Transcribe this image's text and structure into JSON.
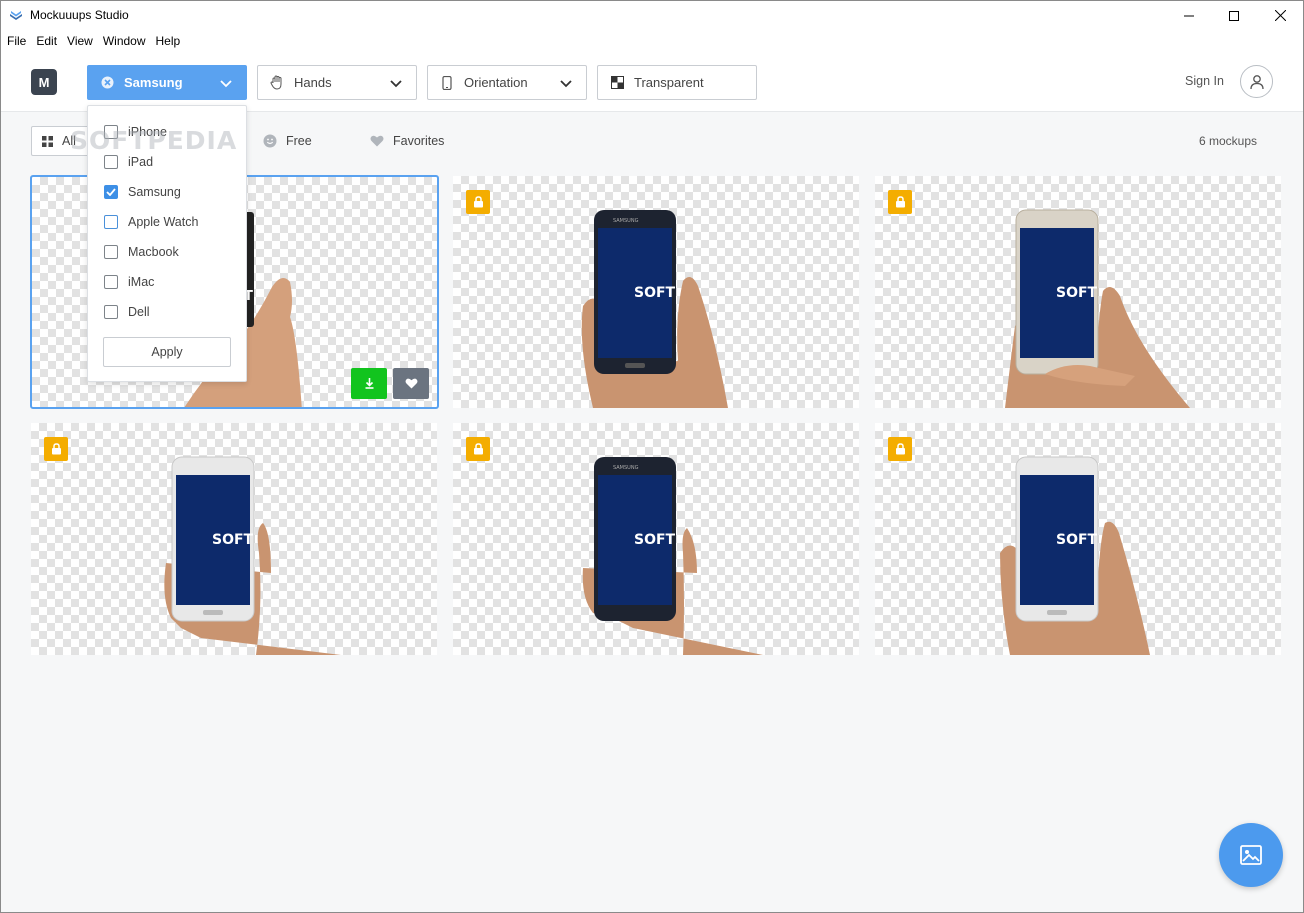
{
  "window": {
    "title": "Mockuuups Studio",
    "icon": "app-icon"
  },
  "menubar": {
    "items": [
      "File",
      "Edit",
      "View",
      "Window",
      "Help"
    ]
  },
  "toolbar": {
    "logo_letter": "M",
    "device_filter": {
      "label": "Samsung",
      "icon": "clear-icon"
    },
    "hands_filter": {
      "label": "Hands",
      "icon": "hand-icon"
    },
    "orientation_filter": {
      "label": "Orientation",
      "icon": "phone-icon"
    },
    "background_filter": {
      "label": "Transparent",
      "icon": "transparent-icon"
    },
    "sign_in": "Sign In"
  },
  "filterbar": {
    "all_label": "All",
    "free_label": "Free",
    "favorites_label": "Favorites",
    "count_label": "6 mockups"
  },
  "device_menu": {
    "options": [
      {
        "label": "iPhone",
        "checked": false
      },
      {
        "label": "iPad",
        "checked": false
      },
      {
        "label": "Samsung",
        "checked": true
      },
      {
        "label": "Apple Watch",
        "checked": false
      },
      {
        "label": "Macbook",
        "checked": false
      },
      {
        "label": "iMac",
        "checked": false
      },
      {
        "label": "Dell",
        "checked": false
      }
    ],
    "apply_label": "Apply"
  },
  "watermark": "SOFTPEDIA",
  "mockups": [
    {
      "phone_color": "black",
      "locked": false,
      "selected": true,
      "screen_text": "SOFT"
    },
    {
      "phone_color": "black",
      "locked": true,
      "selected": false,
      "screen_text": "SOFT"
    },
    {
      "phone_color": "gold",
      "locked": true,
      "selected": false,
      "screen_text": "SOFT"
    },
    {
      "phone_color": "white",
      "locked": true,
      "selected": false,
      "screen_text": "SOFT"
    },
    {
      "phone_color": "black",
      "locked": true,
      "selected": false,
      "screen_text": "SOFT"
    },
    {
      "phone_color": "white",
      "locked": true,
      "selected": false,
      "screen_text": "SOFT"
    }
  ],
  "colors": {
    "accent": "#5aa2f0",
    "lock": "#f4ad00",
    "download": "#12c41e",
    "screen": "#0d2a6b"
  }
}
